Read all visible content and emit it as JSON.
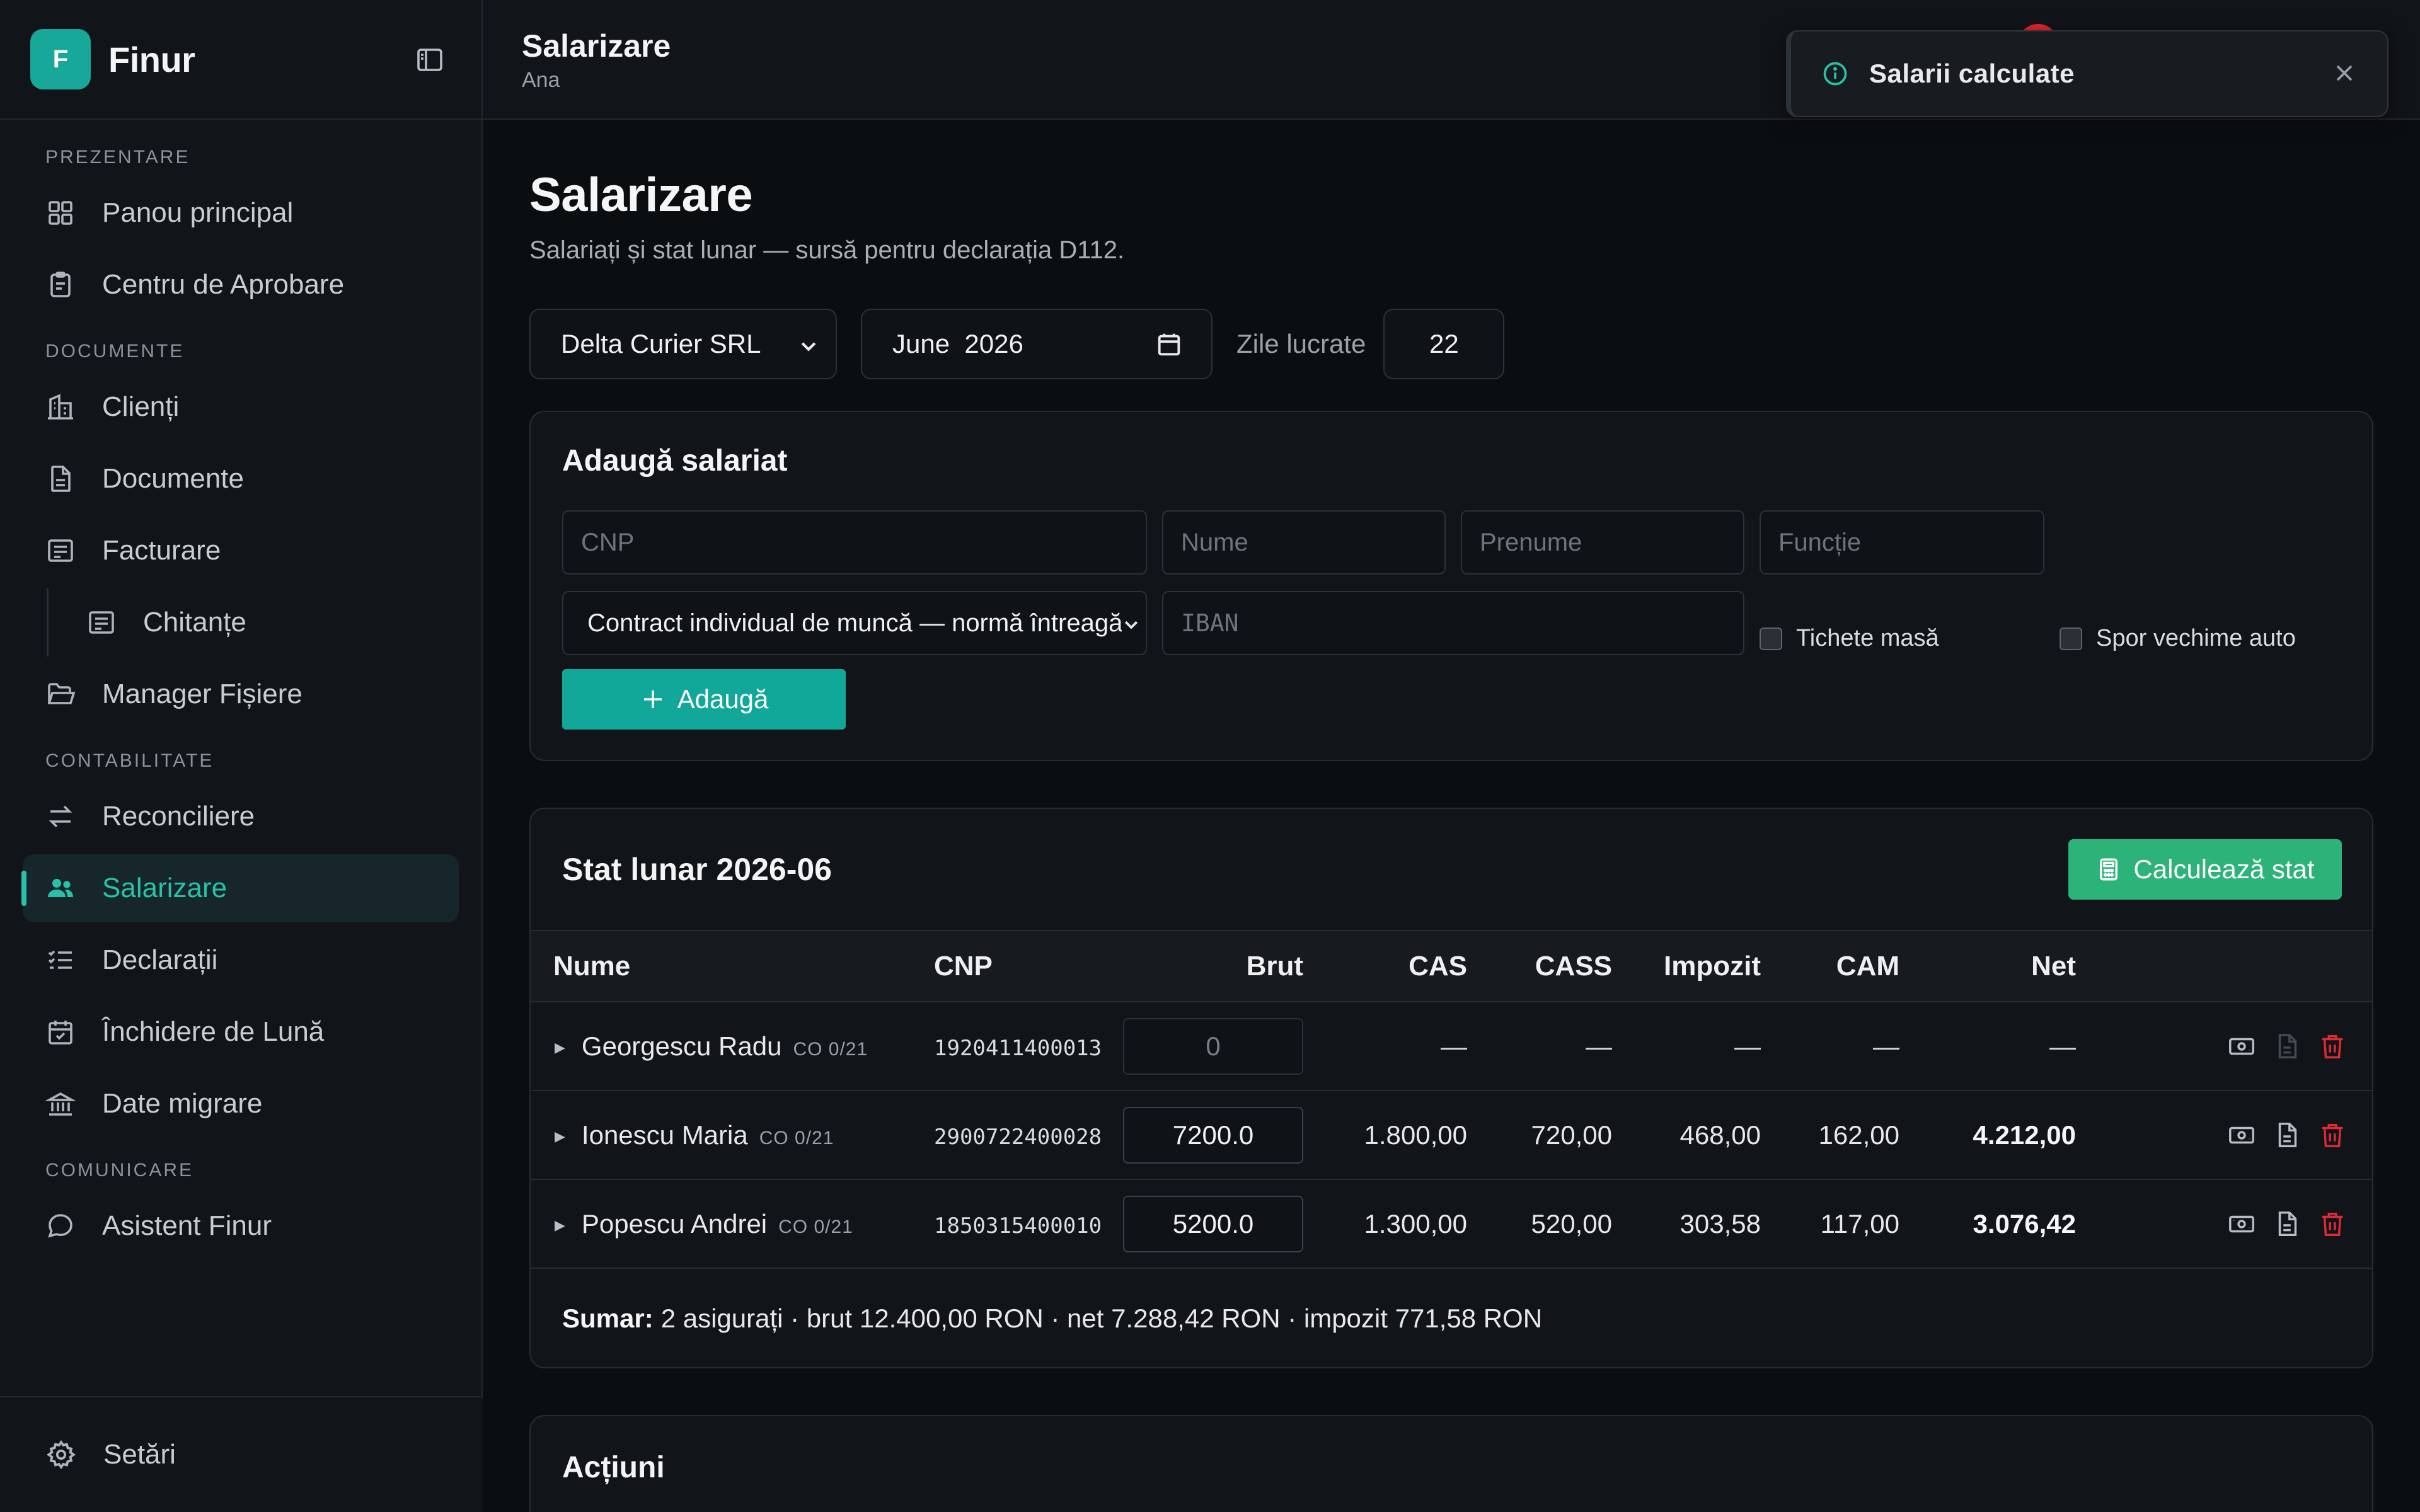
{
  "app": {
    "logo_letter": "F",
    "name": "Finur"
  },
  "sidebar": {
    "sections": [
      {
        "title": "PREZENTARE",
        "items": [
          {
            "label": "Panou principal",
            "icon": "dashboard-icon"
          },
          {
            "label": "Centru de Aprobare",
            "icon": "clipboard-icon"
          }
        ]
      },
      {
        "title": "DOCUMENTE",
        "items": [
          {
            "label": "Clienți",
            "icon": "building-icon"
          },
          {
            "label": "Documente",
            "icon": "document-icon"
          },
          {
            "label": "Facturare",
            "icon": "receipt-icon"
          },
          {
            "label": "Chitanțe",
            "icon": "receipt-icon"
          },
          {
            "label": "Manager Fișiere",
            "icon": "folder-open-icon"
          }
        ]
      },
      {
        "title": "CONTABILITATE",
        "items": [
          {
            "label": "Reconciliere",
            "icon": "arrows-swap-icon"
          },
          {
            "label": "Salarizare",
            "icon": "users-icon",
            "active": true
          },
          {
            "label": "Declarații",
            "icon": "checklist-icon"
          },
          {
            "label": "Închidere de Lună",
            "icon": "calendar-check-icon"
          },
          {
            "label": "Date migrare",
            "icon": "bank-icon"
          }
        ]
      },
      {
        "title": "COMUNICARE",
        "items": [
          {
            "label": "Asistent Finur",
            "icon": "chat-bubble-icon"
          }
        ]
      }
    ],
    "footer": {
      "label": "Setări",
      "icon": "gear-icon"
    }
  },
  "header": {
    "title": "Salarizare",
    "subtitle": "Ana"
  },
  "toast": {
    "message": "Salarii calculate",
    "accent": "#27c2a8"
  },
  "page": {
    "title": "Salarizare",
    "description": "Salariați și stat lunar — sursă pentru declarația D112."
  },
  "filters": {
    "company": "Delta Curier SRL",
    "month": "June  2026",
    "days_label": "Zile lucrate",
    "days_value": "22"
  },
  "add_employee": {
    "title": "Adaugă salariat",
    "placeholders": {
      "cnp": "CNP",
      "nume": "Nume",
      "prenume": "Prenume",
      "functie": "Funcție",
      "iban": "IBAN"
    },
    "contract": "Contract individual de muncă — normă întreagă",
    "checkboxes": {
      "tichete": "Tichete masă",
      "spor": "Spor vechime auto"
    },
    "add_button": "Adaugă"
  },
  "stat": {
    "title": "Stat lunar 2026-06",
    "calc_button": "Calculează stat",
    "columns": [
      "Nume",
      "CNP",
      "Brut",
      "CAS",
      "CASS",
      "Impozit",
      "CAM",
      "Net"
    ],
    "rows": [
      {
        "name": "Georgescu Radu",
        "co": "CO 0/21",
        "cnp": "1920411400013",
        "brut": "0",
        "cas": "—",
        "cass": "—",
        "impozit": "—",
        "cam": "—",
        "net": "—"
      },
      {
        "name": "Ionescu Maria",
        "co": "CO 0/21",
        "cnp": "2900722400028",
        "brut": "7200.0",
        "cas": "1.800,00",
        "cass": "720,00",
        "impozit": "468,00",
        "cam": "162,00",
        "net": "4.212,00"
      },
      {
        "name": "Popescu Andrei",
        "co": "CO 0/21",
        "cnp": "1850315400010",
        "brut": "5200.0",
        "cas": "1.300,00",
        "cass": "520,00",
        "impozit": "303,58",
        "cam": "117,00",
        "net": "3.076,42"
      }
    ],
    "summary_label": "Sumar:",
    "summary_text": "2 asigurați · brut 12.400,00 RON · net 7.288,42 RON · impozit 771,58 RON"
  },
  "actions": {
    "title": "Acțiuni"
  },
  "colors": {
    "accent": "#27c2a8",
    "primary_button": "#11a89a",
    "calc_button": "#2bb37a",
    "danger": "#e02a35"
  }
}
